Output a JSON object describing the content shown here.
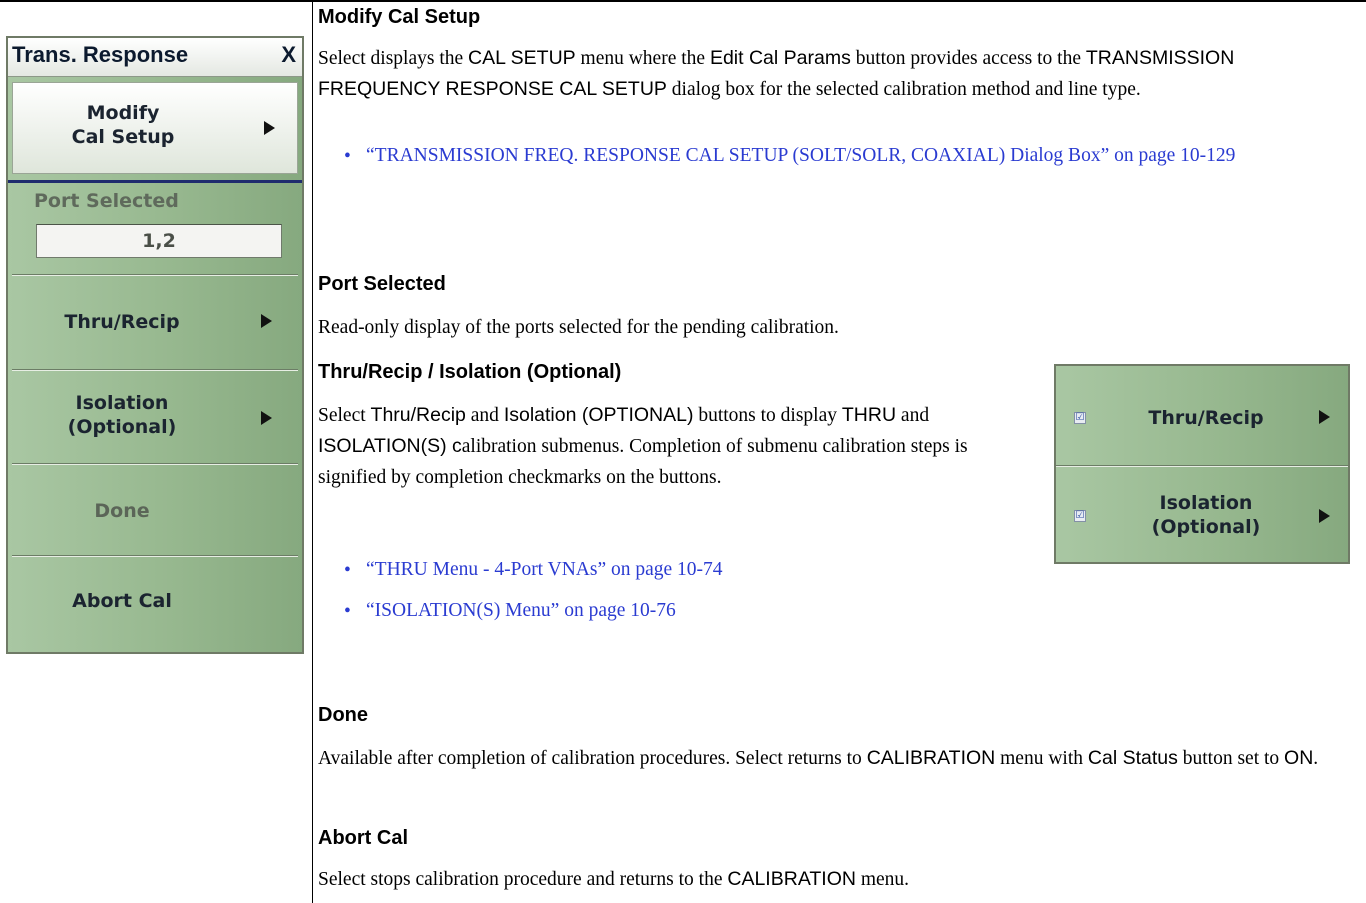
{
  "menu": {
    "title": "Trans. Response",
    "close_label": "X",
    "modify_line1": "Modify",
    "modify_line2": "Cal Setup",
    "port_label": "Port Selected",
    "port_value": "1,2",
    "thru_label": "Thru/Recip",
    "isolation_line1": "Isolation",
    "isolation_line2": "(Optional)",
    "done_label": "Done",
    "abort_label": "Abort Cal"
  },
  "doc": {
    "modify": {
      "heading": "Modify Cal Setup",
      "t1": "Select displays the ",
      "k1": "CAL SETUP",
      "t2": " menu where the ",
      "k2": "Edit Cal Params",
      "t3": " button provides access to the ",
      "k3": "TRANSMISSION FREQUENCY RESPONSE CAL SETUP",
      "t4": " dialog box for the selected calibration method and line type.",
      "link": "“TRANSMISSION FREQ. RESPONSE CAL SETUP (SOLT/SOLR, COAXIAL) Dialog Box” on page 10-129"
    },
    "port": {
      "heading": "Port Selected",
      "body": "Read-only display of the ports selected for the pending calibration."
    },
    "thru": {
      "heading": "Thru/Recip / Isolation (Optional)",
      "t1": "Select ",
      "k1": "Thru/Recip",
      "t2": " and ",
      "k2": "Isolation (OPTIONAL)",
      "t3": " buttons to display ",
      "k3": "THRU",
      "t4": " and ",
      "k4": "ISOLATION(S) c",
      "t5": "alibration submenus. Completion of submenu calibration steps is signified by completion checkmarks on the buttons.",
      "link1": "“THRU Menu - 4-Port VNAs” on page 10-74",
      "link2": "“ISOLATION(S) Menu” on page 10-76"
    },
    "done": {
      "heading": "Done",
      "t1": "Available after completion of calibration procedures. Select returns to ",
      "k1": "CALIBRATION",
      "t2": " menu with ",
      "k2": "Cal Status",
      "t3": " button set to ",
      "k3": "ON",
      "t4": "."
    },
    "abort": {
      "heading": "Abort Cal",
      "t1": "Select stops calibration procedure and returns to the ",
      "k1": "CALIBRATION",
      "t2": " menu."
    }
  },
  "inset": {
    "check_glyph": "☑",
    "thru_label": "Thru/Recip",
    "isolation_line1": "Isolation",
    "isolation_line2": "(Optional)"
  },
  "colors": {
    "menu_green": "#97b88f",
    "link_blue": "#2a3bd1",
    "separator_blue": "#1f2c6e"
  }
}
